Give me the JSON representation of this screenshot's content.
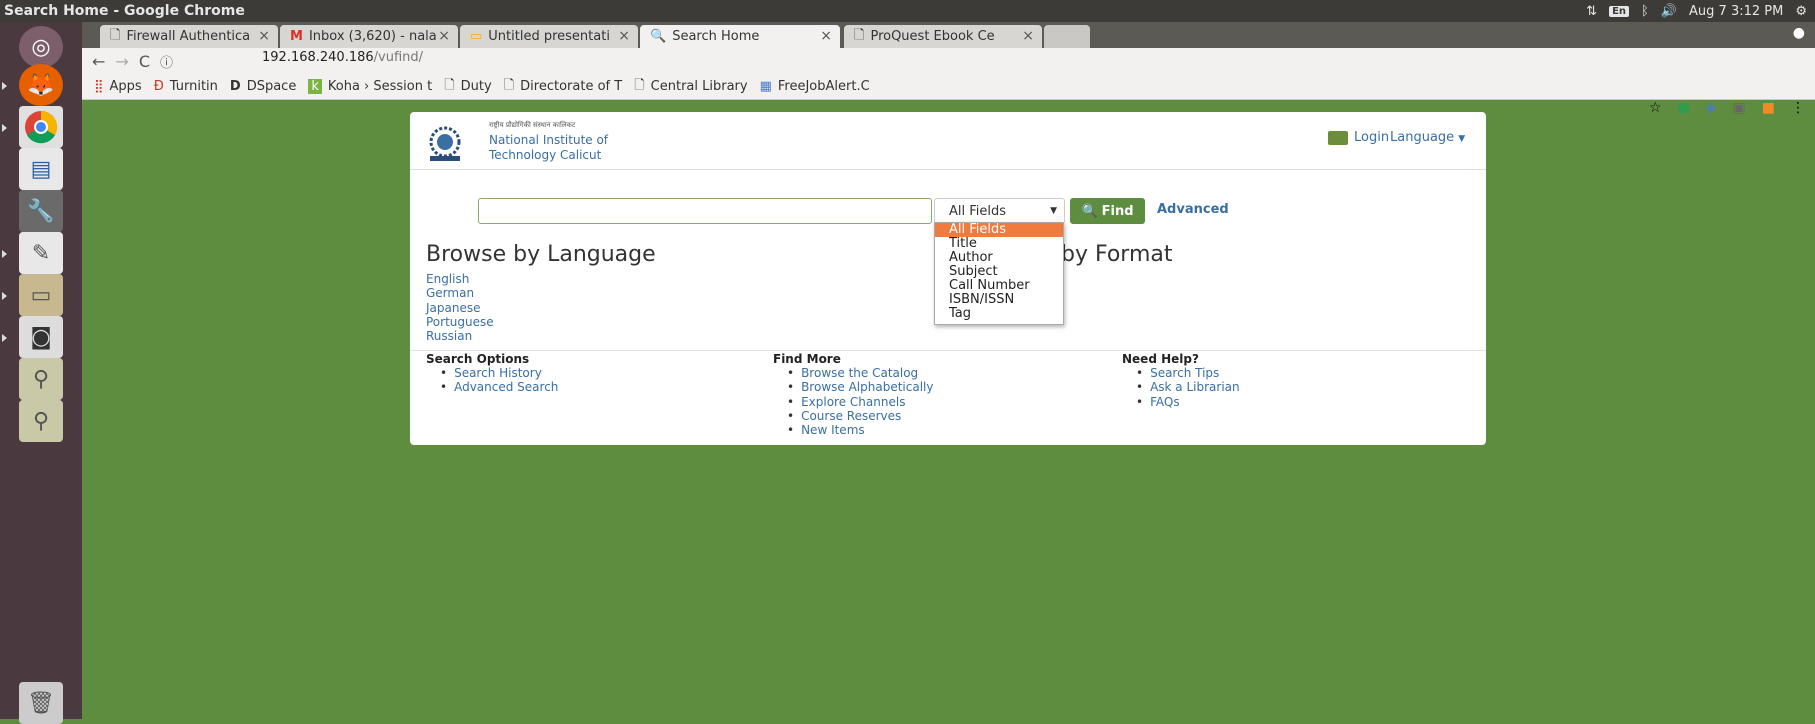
{
  "window_title": "Search Home - Google Chrome",
  "system": {
    "lang": "En",
    "datetime": "Aug 7 3:12 PM"
  },
  "tabs": [
    {
      "label": "Firewall Authentica",
      "icon": "page-icon"
    },
    {
      "label": "Inbox (3,620) - nala",
      "icon": "gmail-icon"
    },
    {
      "label": "Untitled presentati",
      "icon": "slides-icon"
    },
    {
      "label": "Search Home",
      "icon": "vufind-icon",
      "active": true
    },
    {
      "label": "ProQuest Ebook Ce",
      "icon": "page-icon"
    }
  ],
  "address": {
    "host": "192.168.240.186",
    "path": "/vufind/"
  },
  "bookmarks": [
    {
      "label": "Apps",
      "icon": "apps-grid-icon"
    },
    {
      "label": "Turnitin",
      "icon": "turnitin-icon"
    },
    {
      "label": "DSpace",
      "icon": "dspace-icon"
    },
    {
      "label": "Koha › Session t",
      "icon": "koha-icon"
    },
    {
      "label": "Duty",
      "icon": "page-icon"
    },
    {
      "label": "Directorate of T",
      "icon": "page-icon"
    },
    {
      "label": "Central Library",
      "icon": "page-icon"
    },
    {
      "label": "FreeJobAlert.C",
      "icon": "jobalert-icon"
    }
  ],
  "header": {
    "hindi": "राष्ट्रीय प्रौद्योगिकी संस्थान कालिकट",
    "inst_line1": "National Institute of",
    "inst_line2": "Technology Calicut",
    "login": "Login",
    "language": "Language"
  },
  "search": {
    "query": "",
    "selected_field": "All Fields",
    "find": "Find",
    "advanced": "Advanced",
    "field_options": [
      "All Fields",
      "Title",
      "Author",
      "Subject",
      "Call Number",
      "ISBN/ISSN",
      "Tag"
    ]
  },
  "browse_language": {
    "heading": "Browse by Language",
    "items": [
      "English",
      "German",
      "Japanese",
      "Portuguese",
      "Russian"
    ]
  },
  "browse_format": {
    "heading": "by Format"
  },
  "footer": {
    "search_options": {
      "heading": "Search Options",
      "items": [
        "Search History",
        "Advanced Search"
      ]
    },
    "find_more": {
      "heading": "Find More",
      "items": [
        "Browse the Catalog",
        "Browse Alphabetically",
        "Explore Channels",
        "Course Reserves",
        "New Items"
      ]
    },
    "need_help": {
      "heading": "Need Help?",
      "items": [
        "Search Tips",
        "Ask a Librarian",
        "FAQs"
      ]
    }
  },
  "colors": {
    "brand_green": "#5e8d3f",
    "link_blue": "#3a6fa3",
    "dropdown_highlight": "#f07b3f"
  }
}
